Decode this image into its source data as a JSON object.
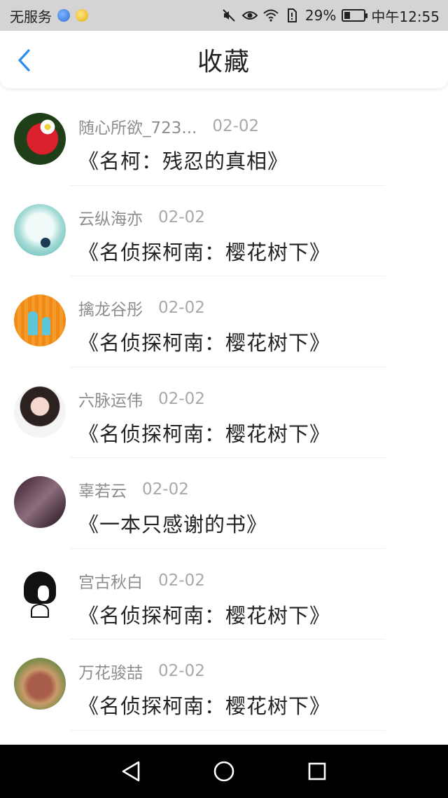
{
  "status_bar": {
    "carrier": "无服务",
    "battery": "29%",
    "battery_level": 0.29,
    "time": "中午12:55"
  },
  "header": {
    "title": "收藏",
    "back_icon": "chevron-left-icon",
    "accent": "#2a8ef0"
  },
  "favorites": [
    {
      "user": "随心所欲_723...",
      "date": "02-02",
      "title": "《名柯：残忍的真相》"
    },
    {
      "user": "云纵海亦",
      "date": "02-02",
      "title": "《名侦探柯南：樱花树下》"
    },
    {
      "user": "擒龙谷彤",
      "date": "02-02",
      "title": "《名侦探柯南：樱花树下》"
    },
    {
      "user": "六脉运伟",
      "date": "02-02",
      "title": "《名侦探柯南：樱花树下》"
    },
    {
      "user": "辜若云",
      "date": "02-02",
      "title": "《一本只感谢的书》"
    },
    {
      "user": "宫古秋白",
      "date": "02-02",
      "title": "《名侦探柯南：樱花树下》"
    },
    {
      "user": "万花骏喆",
      "date": "02-02",
      "title": "《名侦探柯南：樱花树下》"
    }
  ],
  "nav": {
    "back": "triangle-back-icon",
    "home": "circle-home-icon",
    "recents": "square-recents-icon"
  }
}
